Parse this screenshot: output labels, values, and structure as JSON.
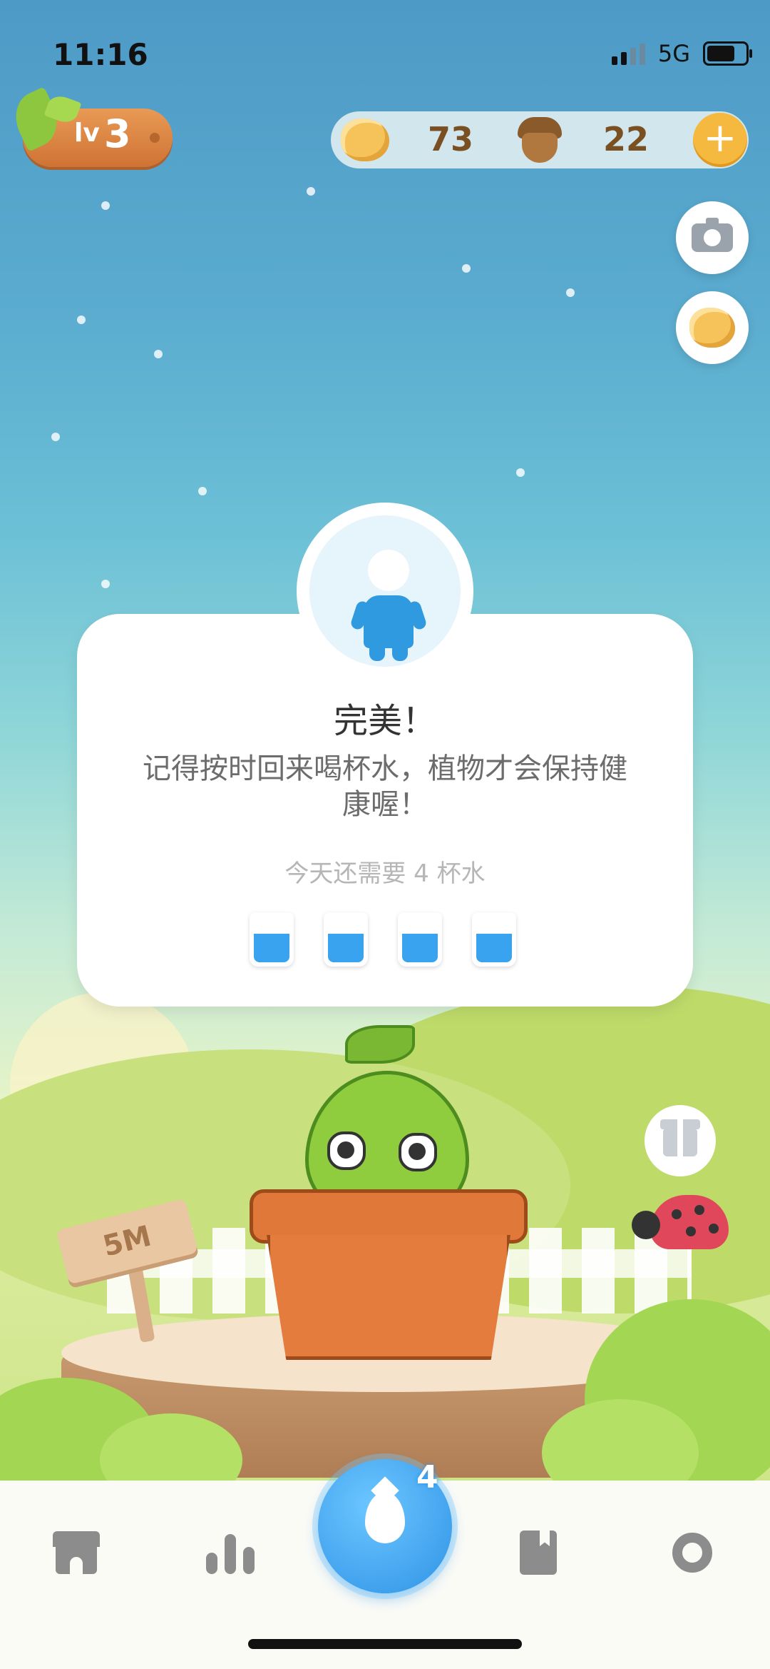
{
  "status_bar": {
    "time": "11:16",
    "network": "5G"
  },
  "player": {
    "level_prefix": "lv",
    "level": "3"
  },
  "currency": {
    "popcorn": "73",
    "acorn": "22",
    "add_label": "+"
  },
  "card": {
    "title": "完美！",
    "message": "记得按时回来喝杯水，植物才会保持健康喔！",
    "remaining_text": "今天还需要 4 杯水",
    "cups_remaining": 4
  },
  "scene": {
    "sign_text": "5M"
  },
  "nav": {
    "water_count": "4"
  },
  "colors": {
    "accent_blue": "#2f93e6",
    "level_orange": "#d97a3a",
    "plant_green": "#8fcd3e"
  }
}
